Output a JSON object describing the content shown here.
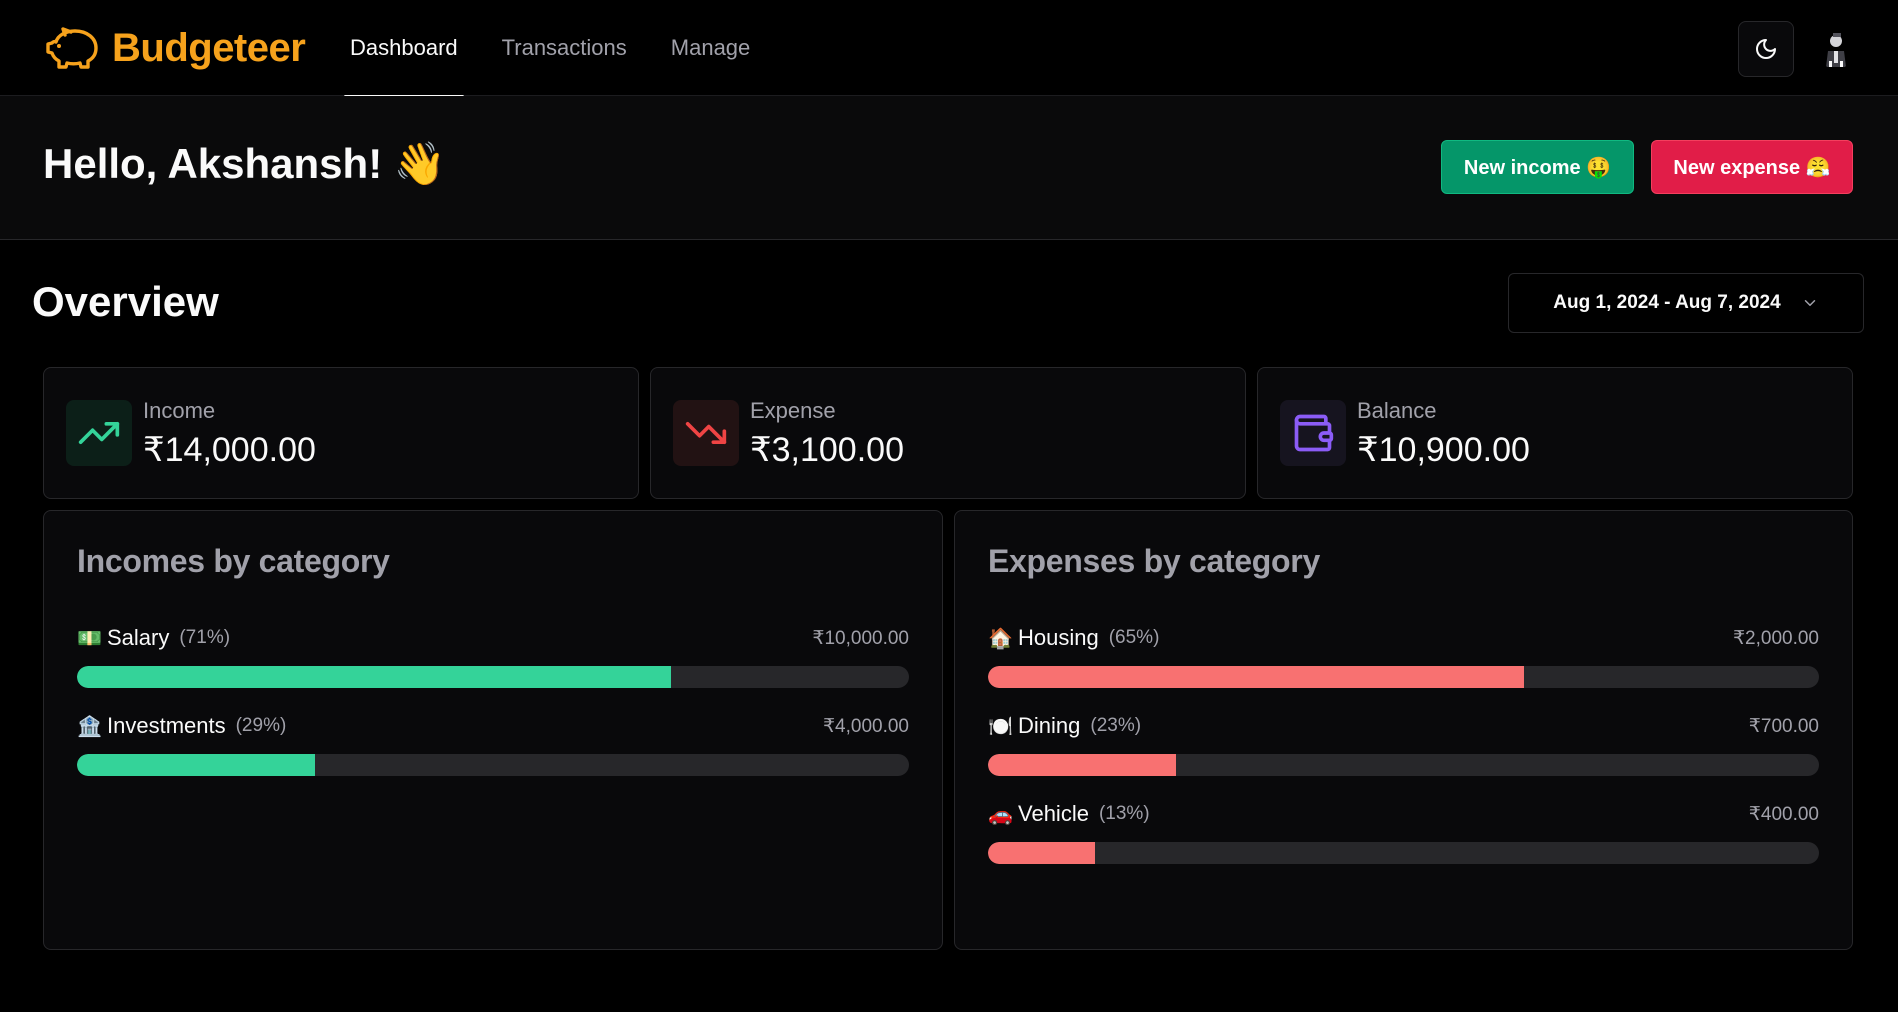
{
  "brand": {
    "name": "Budgeteer"
  },
  "nav": [
    {
      "label": "Dashboard",
      "active": true
    },
    {
      "label": "Transactions",
      "active": false
    },
    {
      "label": "Manage",
      "active": false
    }
  ],
  "header": {
    "theme_icon": "moon-icon",
    "avatar_icon": "user-avatar"
  },
  "greeting": {
    "text": "Hello, Akshansh! 👋"
  },
  "actions": {
    "new_income": "New income 🤑",
    "new_expense": "New expense 😤"
  },
  "overview": {
    "title": "Overview",
    "date_range": "Aug 1, 2024 - Aug 7, 2024"
  },
  "stats": {
    "income": {
      "label": "Income",
      "value": "₹14,000.00",
      "icon": "trending-up-icon",
      "color": "#34d399"
    },
    "expense": {
      "label": "Expense",
      "value": "₹3,100.00",
      "icon": "trending-down-icon",
      "color": "#ef4444"
    },
    "balance": {
      "label": "Balance",
      "value": "₹10,900.00",
      "icon": "wallet-icon",
      "color": "#8b5cf6"
    }
  },
  "incomes": {
    "title": "Incomes by category",
    "items": [
      {
        "emoji": "💵",
        "name": "Salary",
        "pct": "(71%)",
        "amount": "₹10,000.00",
        "fraction": 0.714
      },
      {
        "emoji": "🏦",
        "name": "Investments",
        "pct": "(29%)",
        "amount": "₹4,000.00",
        "fraction": 0.286
      }
    ]
  },
  "expenses": {
    "title": "Expenses by category",
    "items": [
      {
        "emoji": "🏠",
        "name": "Housing",
        "pct": "(65%)",
        "amount": "₹2,000.00",
        "fraction": 0.645
      },
      {
        "emoji": "🍽️",
        "name": "Dining",
        "pct": "(23%)",
        "amount": "₹700.00",
        "fraction": 0.226
      },
      {
        "emoji": "🚗",
        "name": "Vehicle",
        "pct": "(13%)",
        "amount": "₹400.00",
        "fraction": 0.129
      }
    ]
  },
  "colors": {
    "brand": "#f6a21c",
    "income_bar": "#34d399",
    "expense_bar": "#f87171",
    "income_button": "#059669",
    "expense_button": "#e11d48"
  }
}
